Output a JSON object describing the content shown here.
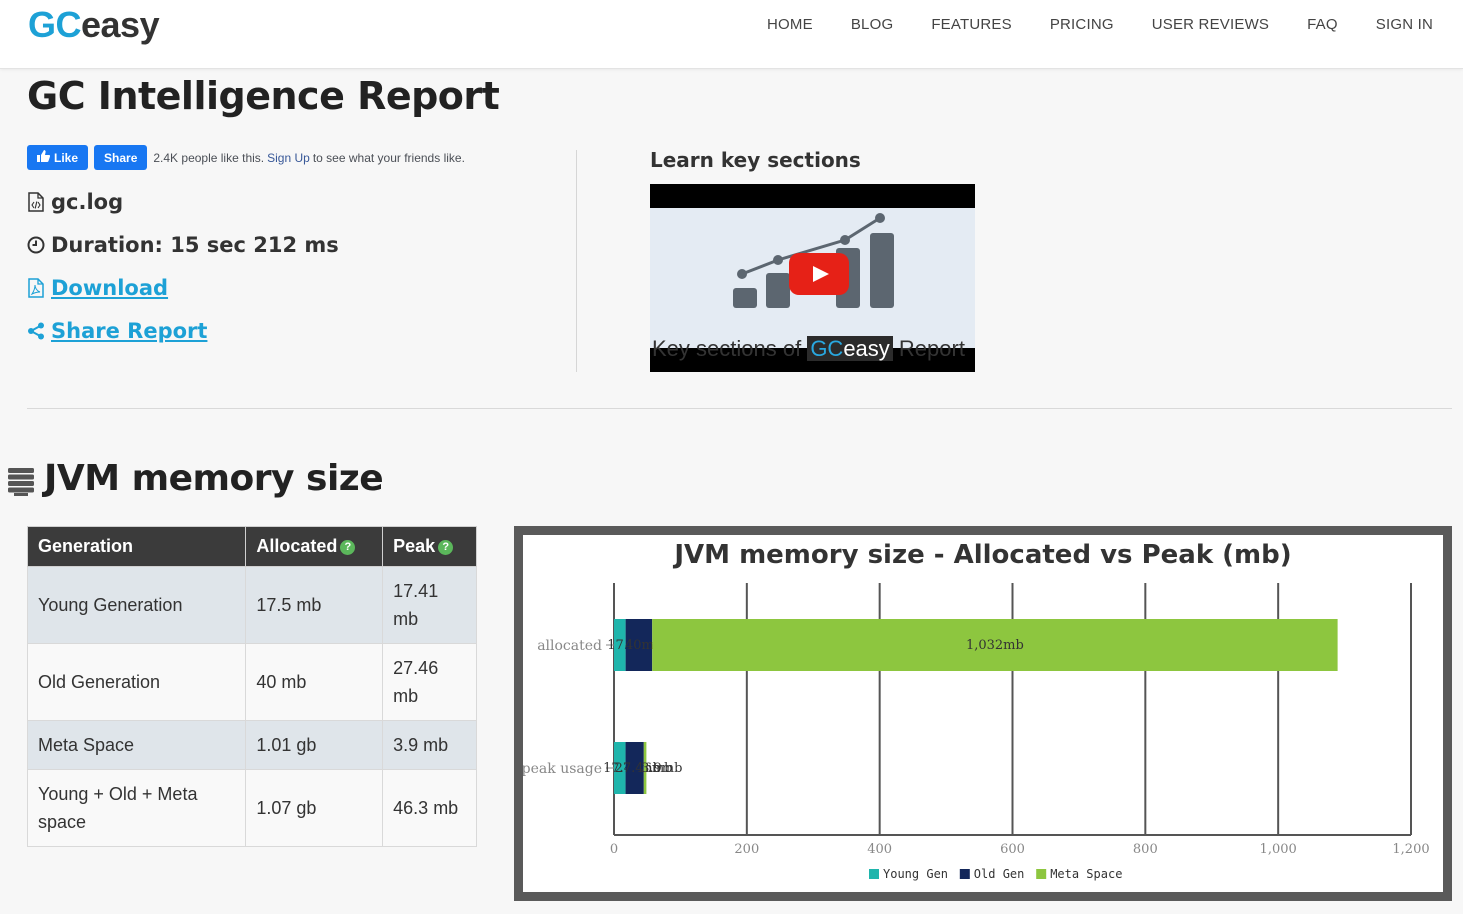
{
  "logo": {
    "part1": "GC",
    "part2": "easy"
  },
  "nav": [
    "HOME",
    "BLOG",
    "FEATURES",
    "PRICING",
    "USER REVIEWS",
    "FAQ",
    "SIGN IN"
  ],
  "page_title": "GC Intelligence Report",
  "social": {
    "like_label": "Like",
    "share_label": "Share",
    "count_text": "2.4K people like this.",
    "signup_link": "Sign Up",
    "suffix": "to see what your friends like."
  },
  "report": {
    "file_name": "gc.log",
    "duration_label": "Duration:",
    "duration_value": "15 sec 212 ms",
    "download_label": "Download",
    "share_report_label": "Share Report"
  },
  "video": {
    "heading": "Learn key sections",
    "caption_pre": "Key sections of",
    "caption_gc": "GC",
    "caption_easy": "easy",
    "caption_post": "Report"
  },
  "section_title": "JVM memory size",
  "table": {
    "headers": [
      "Generation",
      "Allocated",
      "Peak"
    ],
    "rows": [
      {
        "generation": "Young Generation",
        "allocated": "17.5 mb",
        "peak": "17.41 mb"
      },
      {
        "generation": "Old Generation",
        "allocated": "40 mb",
        "peak": "27.46 mb"
      },
      {
        "generation": "Meta Space",
        "allocated": "1.01 gb",
        "peak": "3.9 mb"
      },
      {
        "generation": "Young + Old + Meta space",
        "allocated": "1.07 gb",
        "peak": "46.3 mb"
      }
    ]
  },
  "colors": {
    "young": "#1fb5ac",
    "old": "#13275a",
    "meta": "#8dc63f",
    "accent": "#1da1d6"
  },
  "chart_data": {
    "type": "bar",
    "orientation": "horizontal",
    "stacked": true,
    "title": "JVM memory size - Allocated vs Peak (mb)",
    "categories": [
      "allocated",
      "peak usage"
    ],
    "series": [
      {
        "name": "Young Gen",
        "values": [
          17.5,
          17.41
        ]
      },
      {
        "name": "Old Gen",
        "values": [
          40,
          27.46
        ]
      },
      {
        "name": "Meta Space",
        "values": [
          1032,
          3.9
        ]
      }
    ],
    "data_labels": [
      [
        "17.5mb",
        "17.41mb"
      ],
      [
        "40mb",
        "27.46mb"
      ],
      [
        "1,032mb",
        "3.9mb"
      ]
    ],
    "xlim": [
      0,
      1200
    ],
    "xticks": [
      "0",
      "200",
      "400",
      "600",
      "800",
      "1,000",
      "1,200"
    ],
    "grid": true,
    "legend": "bottom"
  }
}
